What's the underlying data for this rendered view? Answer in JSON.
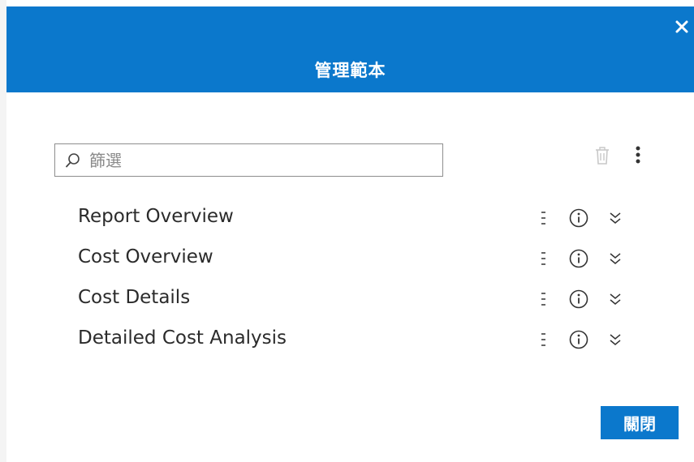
{
  "dialog": {
    "title": "管理範本",
    "close_icon": "close-icon"
  },
  "filter": {
    "placeholder": "篩選",
    "value": ""
  },
  "toolbar": {
    "delete_icon": "trash-icon",
    "more_icon": "more-vertical-icon"
  },
  "templates": [
    {
      "label": "Report Overview"
    },
    {
      "label": "Cost Overview"
    },
    {
      "label": "Cost Details"
    },
    {
      "label": "Detailed Cost Analysis"
    }
  ],
  "footer": {
    "close_label": "關閉"
  },
  "colors": {
    "accent": "#0b78cc",
    "text": "#2b2b2b",
    "icon": "#444444",
    "icon_disabled": "#c8c8c8"
  }
}
